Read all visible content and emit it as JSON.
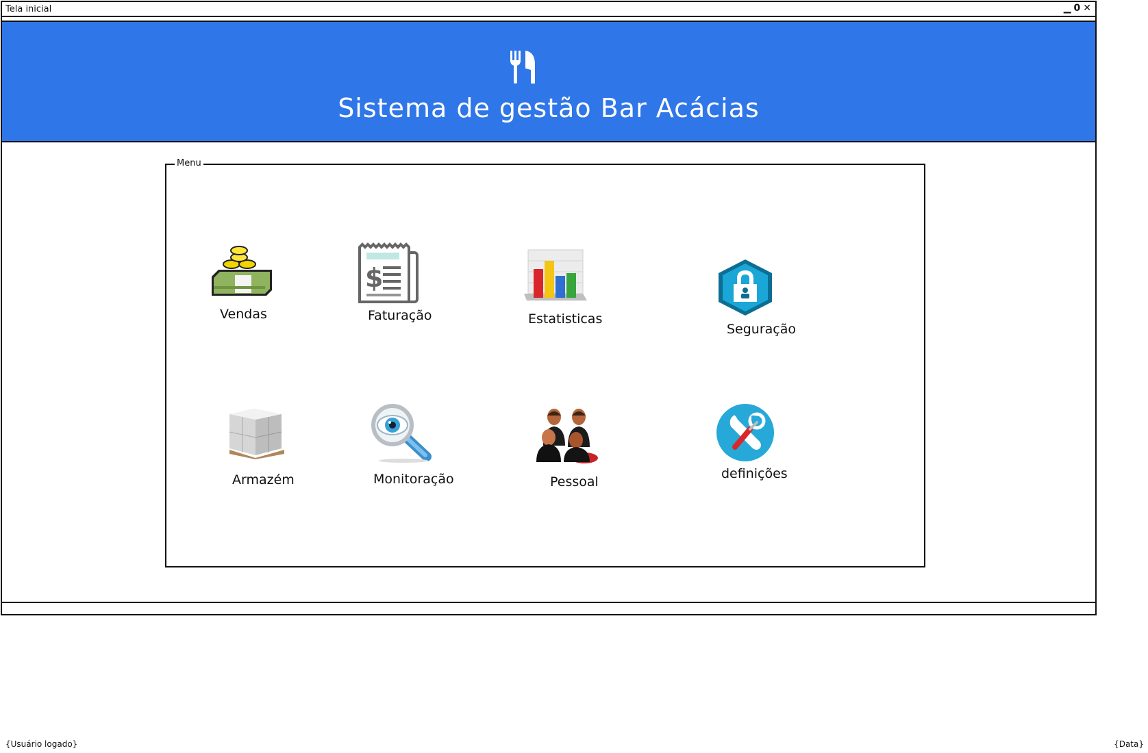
{
  "window": {
    "title": "Tela inicial",
    "controls": {
      "minimize": "▁",
      "maximize": "0",
      "close": "✕"
    }
  },
  "header": {
    "icon": "fork-knife-icon",
    "title": "Sistema de gestão Bar Acácias",
    "color": "#2f76e8"
  },
  "menu": {
    "legend": "Menu",
    "items": [
      {
        "label": "Vendas",
        "icon": "money-stack-icon"
      },
      {
        "label": "Faturação",
        "icon": "invoice-icon"
      },
      {
        "label": "Estatisticas",
        "icon": "bar-chart-icon"
      },
      {
        "label": "Seguração",
        "icon": "lock-icon"
      },
      {
        "label": "Armazém",
        "icon": "boxes-icon"
      },
      {
        "label": "Monitoração",
        "icon": "magnifier-icon"
      },
      {
        "label": "Pessoal",
        "icon": "people-icon"
      },
      {
        "label": "definições",
        "icon": "tools-icon"
      }
    ]
  },
  "footer": {
    "user": "{Usuário logado}",
    "date": "{Data}"
  }
}
